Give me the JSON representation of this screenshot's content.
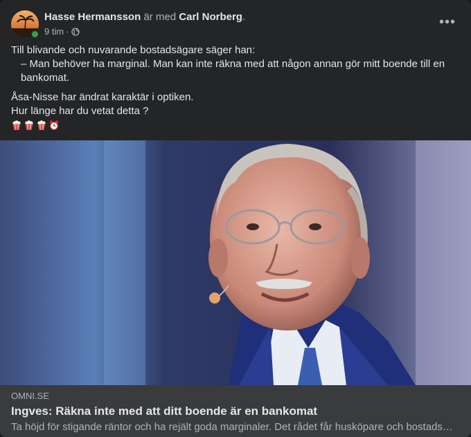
{
  "post": {
    "author": "Hasse Hermansson",
    "with_text": "är med",
    "tagged": "Carl Norberg",
    "period": ".",
    "time": "9 tim",
    "separator": "·",
    "audience_icon": "globe-icon",
    "more_icon": "more-options-icon",
    "more_label": "•••",
    "text": {
      "line1": "Till blivande och nuvarande bostadsägare säger han:",
      "line2": "– Man behöver ha marginal. Man kan inte räkna med att någon annan gör mitt boende till en bankomat.",
      "line3": "Åsa-Nisse har ändrat karaktär i optiken.",
      "line4": "Hur länge har du vetat detta ?",
      "emojis": [
        "popcorn-icon",
        "popcorn-icon",
        "popcorn-icon",
        "alarm-clock-icon"
      ]
    }
  },
  "link": {
    "domain": "OMNI.SE",
    "title": "Ingves: Räkna inte med att ditt boende är en bankomat",
    "description": "Ta höjd för stigande räntor och ha rejält goda marginaler. Det rådet får husköpare och bostads…"
  },
  "colors": {
    "card_bg": "#242526",
    "link_bg": "#3a3b3c",
    "primary_text": "#e4e6eb",
    "secondary_text": "#b0b3b8",
    "online": "#31a24c"
  }
}
